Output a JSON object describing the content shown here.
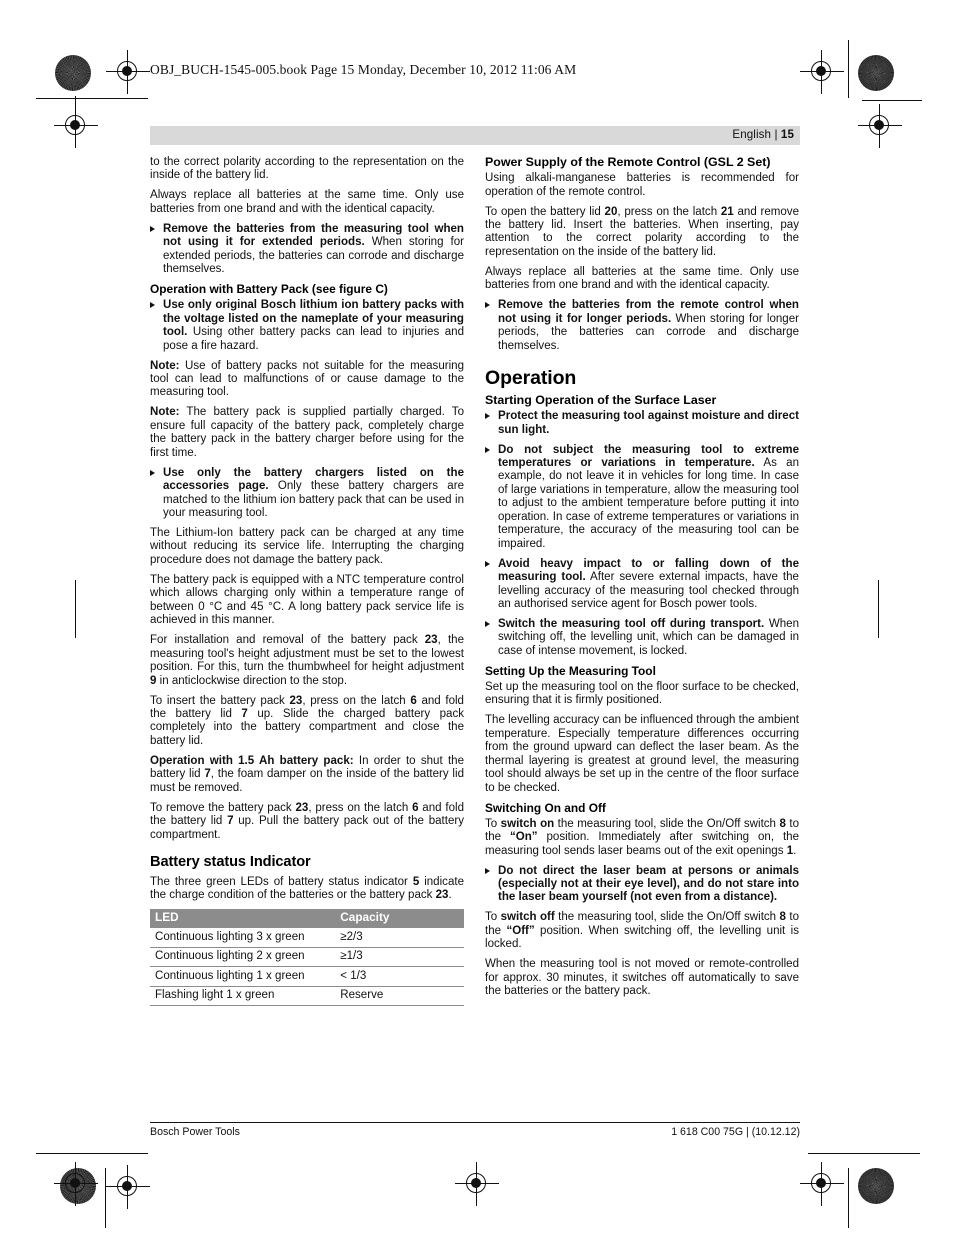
{
  "slug": "OBJ_BUCH-1545-005.book  Page 15  Monday, December 10, 2012  11:06 AM",
  "running_head": {
    "language": "English",
    "separator": "|",
    "page_number": "15"
  },
  "footer": {
    "left": "Bosch Power Tools",
    "right": "1 618 C00 75G | (10.12.12)"
  },
  "left_column": {
    "p1": "to the correct polarity according to the representation on the inside of the battery lid.",
    "p2": "Always replace all batteries at the same time. Only use batteries from one brand and with the identical capacity.",
    "b1_bold": "Remove the batteries from the measuring tool when not using it for extended periods.",
    "b1_rest": " When storing for extended periods, the batteries can corrode and discharge themselves.",
    "h_battery_pack": "Operation with Battery Pack (see figure C)",
    "b2_bold": "Use only original Bosch lithium ion battery packs with the voltage listed on the nameplate of your measuring tool.",
    "b2_rest": " Using other battery packs can lead to injuries and pose a fire hazard.",
    "note1_label": "Note:",
    "note1_rest": " Use of battery packs not suitable for the measuring tool can lead to malfunctions of or cause damage to the measuring tool.",
    "note2_label": "Note:",
    "note2_rest": " The battery pack is supplied partially charged. To ensure full capacity of the battery pack, completely charge the battery pack in the battery charger before using for the first time.",
    "b3_bold": "Use only the battery chargers listed on the accessories page.",
    "b3_rest": " Only these battery chargers are matched to the lithium ion battery pack that can be used in your measuring tool.",
    "p3": "The Lithium-Ion battery pack can be charged at any time without reducing its service life. Interrupting the charging procedure does not damage the battery pack.",
    "p4": "The battery pack is equipped with a NTC temperature control which allows charging only within a temperature range of between 0 °C and 45 °C. A long battery pack service life is achieved in this manner.",
    "p5_a": "For installation and removal of the battery pack ",
    "p5_ref1": "23",
    "p5_b": ", the measuring tool's height adjustment must be set to the lowest position. For this, turn the thumbwheel for height adjustment ",
    "p5_ref2": "9",
    "p5_c": " in anticlockwise direction to the stop.",
    "p6_a": "To insert the battery pack ",
    "p6_ref1": "23",
    "p6_b": ", press on the latch ",
    "p6_ref2": "6",
    "p6_c": " and fold the battery lid ",
    "p6_ref3": "7",
    "p6_d": " up. Slide the charged battery pack completely into the battery compartment and close the battery lid.",
    "p7_bold": "Operation with 1.5 Ah battery pack:",
    "p7_a": " In order to shut the battery lid ",
    "p7_ref1": "7",
    "p7_b": ", the foam damper on the inside of the battery lid must be removed.",
    "p8_a": "To remove the battery pack ",
    "p8_ref1": "23",
    "p8_b": ", press on the latch ",
    "p8_ref2": "6",
    "p8_c": " and fold the battery lid ",
    "p8_ref3": "7",
    "p8_d": " up. Pull the battery pack out of the battery compartment.",
    "h_status": "Battery status Indicator",
    "p9_a": "The three green LEDs of battery status indicator ",
    "p9_ref1": "5",
    "p9_b": " indicate the charge condition of the batteries or the battery pack ",
    "p9_ref2": "23",
    "p9_c": ".",
    "table": {
      "headers": [
        "LED",
        "Capacity"
      ],
      "rows": [
        [
          "Continuous lighting 3 x green",
          "≥2/3"
        ],
        [
          "Continuous lighting 2 x green",
          "≥1/3"
        ],
        [
          "Continuous lighting 1 x green",
          "< 1/3"
        ],
        [
          "Flashing light 1 x green",
          "Reserve"
        ]
      ]
    }
  },
  "right_column": {
    "h_power_supply": "Power Supply of the Remote Control (GSL 2 Set)",
    "p1": "Using alkali-manganese batteries is recommended for operation of the remote control.",
    "p2_a": "To open the battery lid ",
    "p2_ref1": "20",
    "p2_b": ", press on the latch ",
    "p2_ref2": "21",
    "p2_c": " and remove the battery lid. Insert the batteries. When inserting, pay attention to the correct polarity according to the representation on the inside of the battery lid.",
    "p3": "Always replace all batteries at the same time. Only use batteries from one brand and with the identical capacity.",
    "b1_bold": "Remove the batteries from the remote control when not using it for longer periods.",
    "b1_rest": " When storing for longer periods, the batteries can corrode and discharge themselves.",
    "h_operation": "Operation",
    "h_starting": "Starting Operation of the Surface Laser",
    "b2_bold": "Protect the measuring tool against moisture and direct sun light.",
    "b2_rest": "",
    "b3_bold": "Do not subject the measuring tool to extreme temperatures or variations in temperature.",
    "b3_rest": " As an example, do not leave it in vehicles for long time. In case of large variations in temperature, allow the measuring tool to adjust to the ambient temperature before putting it into operation. In case of extreme temperatures or variations in temperature, the accuracy of the measuring tool can be impaired.",
    "b4_bold": "Avoid heavy impact to or falling down of the measuring tool.",
    "b4_rest": " After severe external impacts, have the levelling accuracy of the measuring tool checked through an authorised service agent for Bosch power tools.",
    "b5_bold": "Switch the measuring tool off during transport.",
    "b5_rest": " When switching off, the levelling unit, which can be damaged in case of intense movement, is locked.",
    "h_setting_up": "Setting Up the Measuring Tool",
    "p4": "Set up the measuring tool on the floor surface to be checked, ensuring that it is firmly positioned.",
    "p5": "The levelling accuracy can be influenced through the ambient temperature. Especially temperature differences occurring from the ground upward can deflect the laser beam. As the thermal layering is greatest at ground level, the measuring tool should always be set up in the centre of the floor surface to be checked.",
    "h_switching": "Switching On and Off",
    "p6_a": "To ",
    "p6_b1": "switch on",
    "p6_b": " the measuring tool, slide the On/Off switch ",
    "p6_ref1": "8",
    "p6_c": " to the ",
    "p6_b2": "“On”",
    "p6_d": " position. Immediately after switching on, the measuring tool sends laser beams out of the exit openings ",
    "p6_ref2": "1",
    "p6_e": ".",
    "b6_bold": "Do not direct the laser beam at persons or animals (especially not at their eye level), and do not stare into the laser beam yourself (not even from a distance).",
    "p7_a": "To ",
    "p7_b1": "switch off",
    "p7_b": " the measuring tool, slide the On/Off switch ",
    "p7_ref1": "8",
    "p7_c": " to the ",
    "p7_b2": "“Off”",
    "p7_d": " position. When switching off, the levelling unit is locked.",
    "p8": "When the measuring tool is not moved or remote-controlled for approx. 30 minutes, it switches off automatically to save the batteries or the battery pack."
  }
}
